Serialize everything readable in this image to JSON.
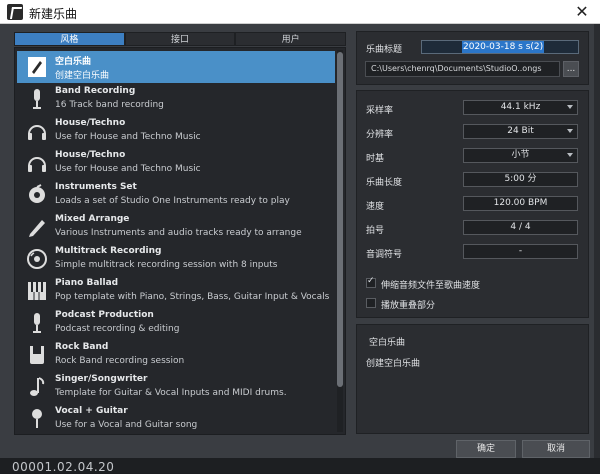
{
  "window": {
    "title": "新建乐曲",
    "close_symbol": "✕"
  },
  "tabs": [
    "风格",
    "接口",
    "用户"
  ],
  "templates": [
    {
      "name": "空白乐曲",
      "desc": "创建空白乐曲",
      "icon": "blank-song-icon",
      "selected": true
    },
    {
      "name": "Band Recording",
      "desc": "16 Track band recording",
      "icon": "microphone-icon"
    },
    {
      "name": "House/Techno",
      "desc": "Use for House and Techno Music",
      "icon": "headphones-icon"
    },
    {
      "name": "House/Techno",
      "desc": "Use for House and Techno Music",
      "icon": "headphones-icon"
    },
    {
      "name": "Instruments Set",
      "desc": "Loads a set of Studio One Instruments ready to play",
      "icon": "instrument-icon"
    },
    {
      "name": "Mixed Arrange",
      "desc": "Various Instruments and audio tracks ready to arrange",
      "icon": "pen-icon"
    },
    {
      "name": "Multitrack Recording",
      "desc": "Simple multitrack recording session with 8 inputs",
      "icon": "disc-icon"
    },
    {
      "name": "Piano Ballad",
      "desc": "Pop template with Piano, Strings, Bass, Guitar Input & Vocals",
      "icon": "piano-icon"
    },
    {
      "name": "Podcast Production",
      "desc": "Podcast recording & editing",
      "icon": "microphone-icon"
    },
    {
      "name": "Rock Band",
      "desc": "Rock Band recording session",
      "icon": "rock-hand-icon"
    },
    {
      "name": "Singer/Songwriter",
      "desc": "Template for Guitar & Vocal Inputs and MIDI drums.",
      "icon": "music-note-icon"
    },
    {
      "name": "Vocal + Guitar",
      "desc": "Use for a Vocal and Guitar song",
      "icon": "microphone-icon"
    }
  ],
  "song": {
    "title_label": "乐曲标题",
    "title_value": "2020-03-18 s s(2)",
    "path_value": "C:\\Users\\chenrq\\Documents\\StudioO..ongs",
    "browse_label": "..."
  },
  "settings": [
    {
      "label": "采样率",
      "value": "44.1 kHz",
      "dropdown": true
    },
    {
      "label": "分辨率",
      "value": "24 Bit",
      "dropdown": true
    },
    {
      "label": "时基",
      "value": "小节",
      "dropdown": true
    },
    {
      "label": "乐曲长度",
      "value": "5:00 分",
      "dropdown": false
    },
    {
      "label": "速度",
      "value": "120.00 BPM",
      "dropdown": false
    },
    {
      "label": "拍号",
      "value": "4  /  4",
      "dropdown": false
    },
    {
      "label": "音调符号",
      "value": "-",
      "dropdown": false
    }
  ],
  "options": [
    {
      "label": "伸缩音频文件至歌曲速度",
      "checked": true
    },
    {
      "label": "播放重叠部分",
      "checked": false
    }
  ],
  "description": {
    "title": "空白乐曲",
    "text": "创建空白乐曲"
  },
  "buttons": {
    "ok": "确定",
    "cancel": "取消"
  },
  "background": {
    "time": "00001.02.04.20"
  }
}
